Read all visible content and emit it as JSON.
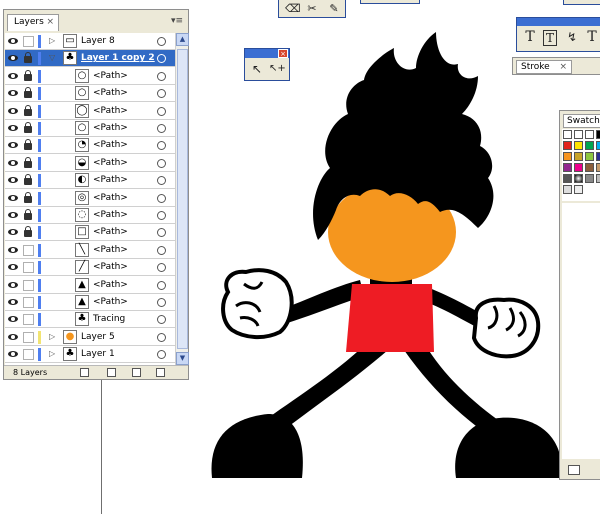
{
  "layers_panel": {
    "tab_label": "Layers",
    "tab_close": "×",
    "menu_glyph": "▾≡",
    "count_label": "8 Layers",
    "rows": [
      {
        "name": "Layer 8",
        "kind": "layer",
        "locked": false,
        "color": "#4f7ff0",
        "selected": false,
        "glyph": "▭"
      },
      {
        "name": "Layer 1 copy 2",
        "kind": "layer",
        "locked": true,
        "color": "#4f7ff0",
        "selected": true,
        "glyph": "♣"
      },
      {
        "name": "<Path>",
        "kind": "path",
        "locked": true,
        "color": "#4f7ff0",
        "glyph": "○"
      },
      {
        "name": "<Path>",
        "kind": "path",
        "locked": true,
        "color": "#4f7ff0",
        "glyph": "○"
      },
      {
        "name": "<Path>",
        "kind": "path",
        "locked": true,
        "color": "#4f7ff0",
        "glyph": "◯"
      },
      {
        "name": "<Path>",
        "kind": "path",
        "locked": true,
        "color": "#4f7ff0",
        "glyph": "○"
      },
      {
        "name": "<Path>",
        "kind": "path",
        "locked": true,
        "color": "#4f7ff0",
        "glyph": "◔"
      },
      {
        "name": "<Path>",
        "kind": "path",
        "locked": true,
        "color": "#4f7ff0",
        "glyph": "◒"
      },
      {
        "name": "<Path>",
        "kind": "path",
        "locked": true,
        "color": "#4f7ff0",
        "glyph": "◐"
      },
      {
        "name": "<Path>",
        "kind": "path",
        "locked": true,
        "color": "#4f7ff0",
        "glyph": "◎"
      },
      {
        "name": "<Path>",
        "kind": "path",
        "locked": true,
        "color": "#4f7ff0",
        "glyph": "◌"
      },
      {
        "name": "<Path>",
        "kind": "path",
        "locked": true,
        "color": "#4f7ff0",
        "glyph": "□"
      },
      {
        "name": "<Path>",
        "kind": "path",
        "locked": false,
        "color": "#4f7ff0",
        "glyph": "╲"
      },
      {
        "name": "<Path>",
        "kind": "path",
        "locked": false,
        "color": "#4f7ff0",
        "glyph": "╱"
      },
      {
        "name": "<Path>",
        "kind": "path",
        "locked": false,
        "color": "#4f7ff0",
        "glyph": "▲"
      },
      {
        "name": "<Path>",
        "kind": "path",
        "locked": false,
        "color": "#4f7ff0",
        "glyph": "▲"
      },
      {
        "name": "Tracing",
        "kind": "path",
        "locked": false,
        "color": "#4f7ff0",
        "glyph": "♣"
      },
      {
        "name": "Layer 5",
        "kind": "layer",
        "locked": false,
        "color": "#f2e472",
        "selected": false,
        "glyph": "●"
      },
      {
        "name": "Layer 1",
        "kind": "layer",
        "locked": false,
        "color": "#4f7ff0",
        "selected": false,
        "glyph": "♣"
      }
    ]
  },
  "stroke_panel": {
    "tab_label": "Stroke",
    "tab_close": "×"
  },
  "swatches_panel": {
    "tab_label": "Swatche"
  },
  "type_tools": {
    "labels": [
      "T",
      "T",
      "↯",
      "T"
    ]
  },
  "small_tools": {
    "close": "×",
    "labels": [
      "↖",
      "↖+"
    ]
  },
  "top_toolbar": {
    "labels": [
      "⌫",
      "✂",
      "✎"
    ]
  },
  "colors": {
    "hair": "#000000",
    "face": "#f5961e",
    "shirt": "#ee1c24",
    "limbs": "#000000",
    "selection": "#316ac5"
  }
}
